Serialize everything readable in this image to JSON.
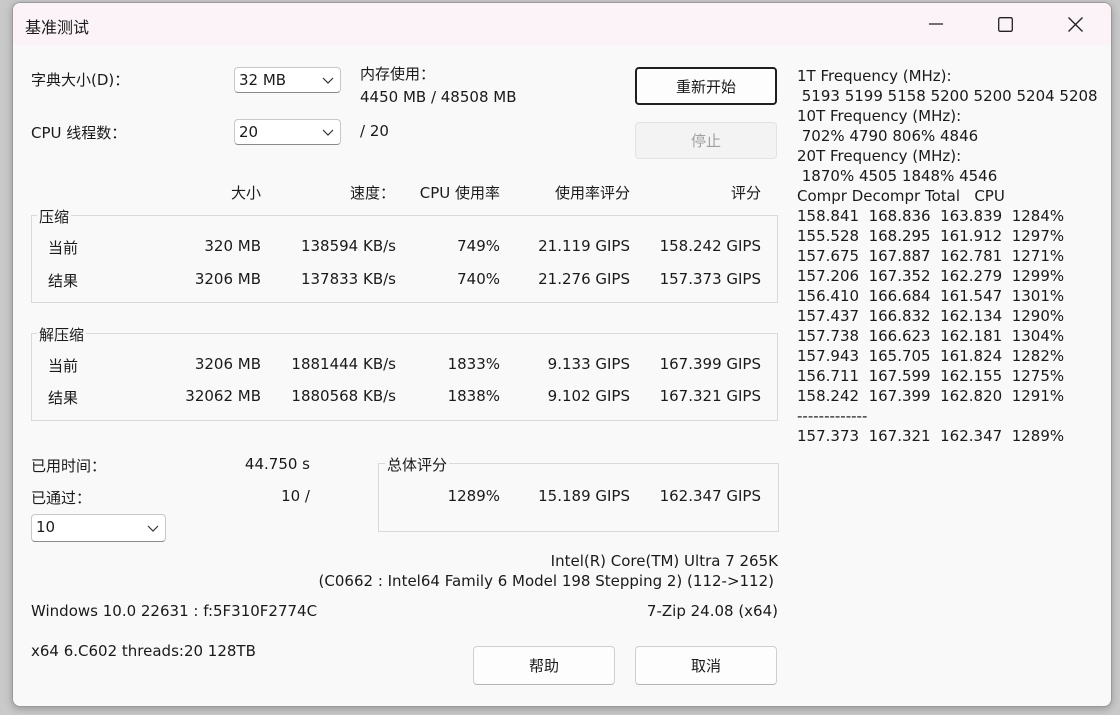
{
  "window": {
    "title": "基准测试"
  },
  "settings": {
    "dict_label": "字典大小(D)：",
    "dict_value": "32 MB",
    "threads_label": "CPU 线程数：",
    "threads_value": "20",
    "threads_total": "/ 20",
    "mem_label": "内存使用：",
    "mem_value": "4450 MB / 48508 MB"
  },
  "buttons": {
    "restart": "重新开始",
    "stop": "停止",
    "help": "帮助",
    "cancel": "取消"
  },
  "table": {
    "headers": {
      "size": "大小",
      "speed": "速度：",
      "cpu": "CPU 使用率",
      "rating_usage": "使用率评分",
      "rating": "评分"
    },
    "compress": {
      "label": "压缩",
      "rows": [
        {
          "label": "当前",
          "size": "320 MB",
          "speed": "138594 KB/s",
          "cpu": "749%",
          "usage": "21.119 GIPS",
          "rating": "158.242 GIPS"
        },
        {
          "label": "结果",
          "size": "3206 MB",
          "speed": "137833 KB/s",
          "cpu": "740%",
          "usage": "21.276 GIPS",
          "rating": "157.373 GIPS"
        }
      ]
    },
    "decompress": {
      "label": "解压缩",
      "rows": [
        {
          "label": "当前",
          "size": "3206 MB",
          "speed": "1881444 KB/s",
          "cpu": "1833%",
          "usage": "9.133 GIPS",
          "rating": "167.399 GIPS"
        },
        {
          "label": "结果",
          "size": "32062 MB",
          "speed": "1880568 KB/s",
          "cpu": "1838%",
          "usage": "9.102 GIPS",
          "rating": "167.321 GIPS"
        }
      ]
    }
  },
  "status": {
    "elapsed_label": "已用时间：",
    "elapsed_value": "44.750 s",
    "passed_label": "已通过：",
    "passed_value": "10 /",
    "passes_select": "10"
  },
  "total": {
    "label": "总体评分",
    "cpu": "1289%",
    "usage": "15.189 GIPS",
    "rating": "162.347 GIPS"
  },
  "sysinfo": {
    "cpu_name": "Intel(R) Core(TM) Ultra 7 265K",
    "cpu_detail": "(C0662 : Intel64 Family 6 Model 198 Stepping 2) (112->112)",
    "os": "Windows 10.0 22631 :  f:5F310F2774C",
    "version": "7-Zip 24.08 (x64)",
    "arch": "x64 6.C602 threads:20 128TB"
  },
  "freq_panel": {
    "lines": [
      "1T Frequency (MHz):",
      " 5193 5199 5158 5200 5200 5204 5208",
      "10T Frequency (MHz):",
      " 702% 4790 806% 4846",
      "20T Frequency (MHz):",
      " 1870% 4505 1848% 4546",
      "Compr Decompr Total   CPU",
      "158.841  168.836  163.839  1284%",
      "155.528  168.295  161.912  1297%",
      "157.675  167.887  162.781  1271%",
      "157.206  167.352  162.279  1299%",
      "156.410  166.684  161.547  1301%",
      "157.437  166.832  162.134  1290%",
      "157.738  166.623  162.181  1304%",
      "157.943  165.705  161.824  1282%",
      "156.711  167.599  162.155  1275%",
      "158.242  167.399  162.820  1291%",
      "-------------",
      "157.373  167.321  162.347  1289%"
    ]
  }
}
